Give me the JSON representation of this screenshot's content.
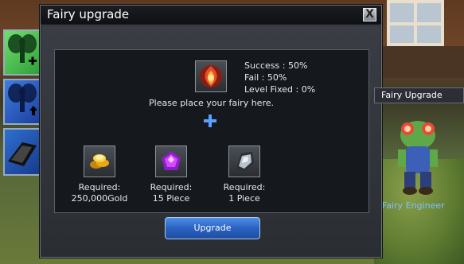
{
  "dialog": {
    "title": "Fairy upgrade",
    "close_label": "X",
    "stats": {
      "success": "Success : 50%",
      "fail": "Fail : 50%",
      "level_fixed": "Level Fixed : 0%"
    },
    "instruction": "Please place your fairy here.",
    "requirements": [
      {
        "icon": "gold-coins-icon",
        "line1": "Required:",
        "line2": "250,000Gold"
      },
      {
        "icon": "purple-gem-icon",
        "line1": "Required:",
        "line2": "15 Piece"
      },
      {
        "icon": "silver-ore-icon",
        "line1": "Required:",
        "line2": "1 Piece"
      }
    ],
    "upgrade_label": "Upgrade"
  },
  "npc": {
    "label": "Fairy Upgrade",
    "name": "Fairy Engineer"
  },
  "skills": [
    {
      "icon": "fairy-plus-icon",
      "color": "#4fd060"
    },
    {
      "icon": "fairy-up-icon",
      "color": "#2f62c8"
    },
    {
      "icon": "whetstone-icon",
      "color": "#2f62c8"
    }
  ]
}
